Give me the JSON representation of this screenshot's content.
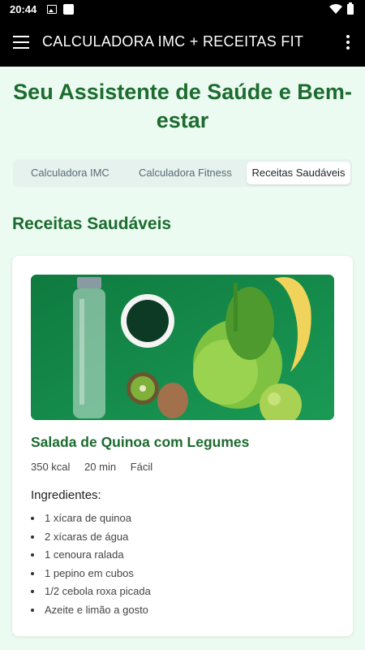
{
  "status_bar": {
    "time": "20:44"
  },
  "app_bar": {
    "title": "CALCULADORA IMC + RECEITAS FIT"
  },
  "page": {
    "title": "Seu Assistente de Saúde e Bem-estar"
  },
  "tabs": [
    {
      "label": "Calculadora IMC",
      "active": false
    },
    {
      "label": "Calculadora Fitness",
      "active": false
    },
    {
      "label": "Receitas Saudáveis",
      "active": true
    }
  ],
  "section": {
    "title": "Receitas Saudáveis"
  },
  "recipe": {
    "name": "Salada de Quinoa com Legumes",
    "calories": "350 kcal",
    "time": "20 min",
    "difficulty": "Fácil",
    "ingredients_title": "Ingredientes:",
    "ingredients": [
      "1 xícara de quinoa",
      "2 xícaras de água",
      "1 cenoura ralada",
      "1 pepino em cubos",
      "1/2 cebola roxa picada",
      "Azeite e limão a gosto"
    ]
  },
  "colors": {
    "accent": "#1c6b2f",
    "background": "#ecfbf1",
    "appbar": "#000000"
  }
}
